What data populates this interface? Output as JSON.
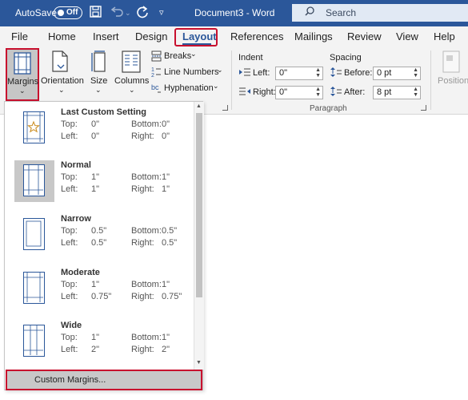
{
  "titlebar": {
    "autosave_label": "AutoSave",
    "autosave_state": "Off",
    "document_title": "Document3  -  Word",
    "search_placeholder": "Search",
    "accent_color": "#2b579a",
    "icons": [
      "save-icon",
      "undo-icon",
      "redo-icon",
      "customize-quick-access-icon",
      "search-icon"
    ]
  },
  "tabs": [
    {
      "label": "File"
    },
    {
      "label": "Home"
    },
    {
      "label": "Insert"
    },
    {
      "label": "Design"
    },
    {
      "label": "Layout",
      "active": true
    },
    {
      "label": "References"
    },
    {
      "label": "Mailings"
    },
    {
      "label": "Review"
    },
    {
      "label": "View"
    },
    {
      "label": "Help"
    }
  ],
  "ribbon": {
    "margins": "Margins",
    "orientation": "Orientation",
    "size": "Size",
    "columns": "Columns",
    "breaks": "Breaks",
    "line_numbers": "Line Numbers",
    "hyphenation": "Hyphenation",
    "indent_title": "Indent",
    "spacing_title": "Spacing",
    "left_label": "Left:",
    "right_label": "Right:",
    "before_label": "Before:",
    "after_label": "After:",
    "left_value": "0\"",
    "right_value": "0\"",
    "before_value": "0 pt",
    "after_value": "8 pt",
    "paragraph_group": "Paragraph",
    "position": "Position"
  },
  "margins_menu": {
    "labels": {
      "top": "Top:",
      "bottom": "Bottom:",
      "left": "Left:",
      "right": "Right:"
    },
    "items": [
      {
        "name": "Last Custom Setting",
        "top": "0\"",
        "bottom": "0\"",
        "left": "0\"",
        "right": "0\""
      },
      {
        "name": "Normal",
        "top": "1\"",
        "bottom": "1\"",
        "left": "1\"",
        "right": "1\"",
        "selected": true
      },
      {
        "name": "Narrow",
        "top": "0.5\"",
        "bottom": "0.5\"",
        "left": "0.5\"",
        "right": "0.5\""
      },
      {
        "name": "Moderate",
        "top": "1\"",
        "bottom": "1\"",
        "left": "0.75\"",
        "right": "0.75\""
      },
      {
        "name": "Wide",
        "top": "1\"",
        "bottom": "1\"",
        "left": "2\"",
        "right": "2\""
      }
    ],
    "custom_margins": "Custom Margins..."
  },
  "highlight_color": "#c8102e"
}
